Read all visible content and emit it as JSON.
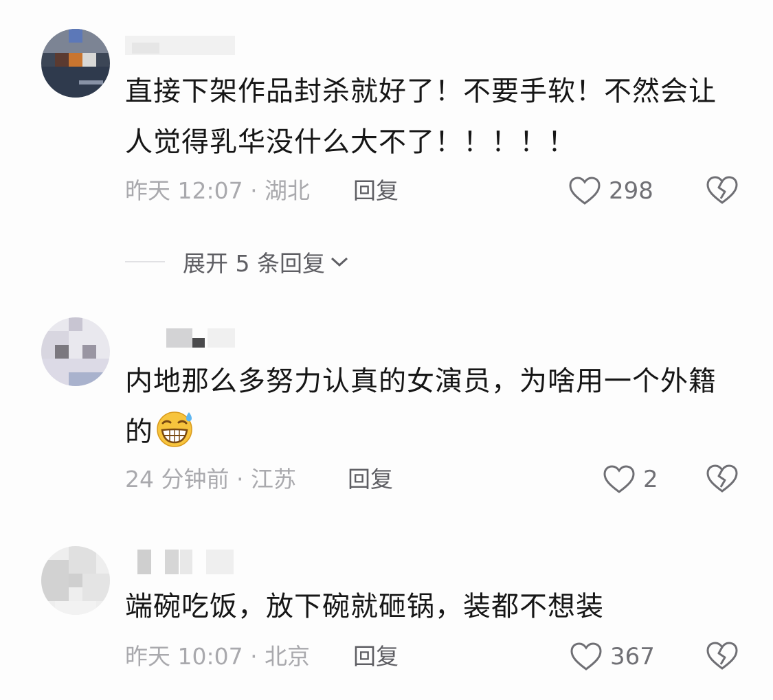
{
  "comments": [
    {
      "text": "直接下架作品封杀就好了！不要手软！不然会让人觉得乳华没什么大不了！！！！！",
      "time": "昨天 12:07",
      "location": "湖北",
      "meta": "昨天 12:07 · 湖北",
      "reply_label": "回复",
      "likes": "298",
      "expand_label": "展开 5 条回复"
    },
    {
      "text": "内地那么多努力认真的女演员，为啥用一个外籍的",
      "emoji": "grinning-sweat-emoji",
      "time": "24 分钟前",
      "location": "江苏",
      "meta": "24 分钟前 · 江苏",
      "reply_label": "回复",
      "likes": "2"
    },
    {
      "text": "端碗吃饭，放下碗就砸锅，装都不想装",
      "time": "昨天 10:07",
      "location": "北京",
      "meta": "昨天 10:07 · 北京",
      "reply_label": "回复",
      "likes": "367"
    }
  ],
  "icons": {
    "like": "heart-outline-icon",
    "dislike": "broken-heart-icon",
    "expand": "chevron-down-icon"
  },
  "colors": {
    "text": "#161616",
    "meta": "#a9a9ad",
    "action": "#5e5e63",
    "icon": "#6f6f74"
  }
}
